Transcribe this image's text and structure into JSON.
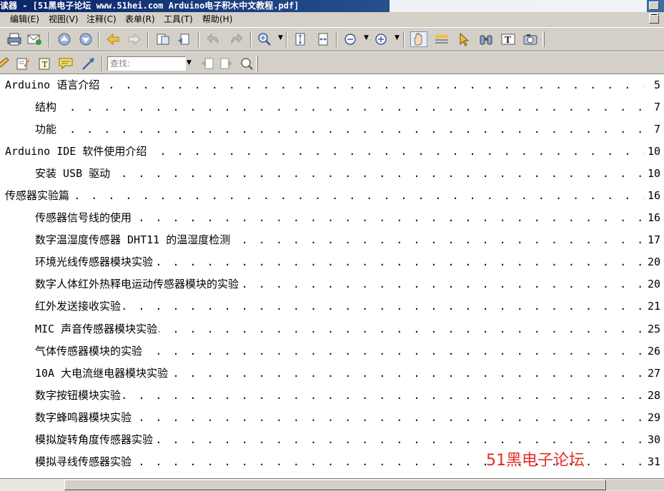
{
  "window": {
    "title": "读器 - [51黑电子论坛 www.51hei.com Arduino电子积木中文教程.pdf]"
  },
  "menu": [
    "编辑(E)",
    "视图(V)",
    "注释(C)",
    "表单(R)",
    "工具(T)",
    "帮助(H)"
  ],
  "toolbar2": {
    "find_placeholder": "查找:"
  },
  "toc": [
    {
      "title": "Arduino 语言介绍",
      "page": "5"
    },
    {
      "title": "结构",
      "page": "7"
    },
    {
      "title": "功能",
      "page": "7"
    },
    {
      "title": "Arduino IDE 软件使用介绍",
      "page": "10"
    },
    {
      "title": "安装 USB 驱动",
      "page": "10"
    },
    {
      "title": "传感器实验篇",
      "page": "16"
    },
    {
      "title": "传感器信号线的使用",
      "page": "16"
    },
    {
      "title": "数字温湿度传感器 DHT11 的温湿度检测",
      "page": "17"
    },
    {
      "title": "环境光线传感器模块实验",
      "page": "20"
    },
    {
      "title": "数字人体红外热释电运动传感器模块的实验",
      "page": "20"
    },
    {
      "title": "红外发送接收实验",
      "page": "21"
    },
    {
      "title": "MIC 声音传感器模块实验",
      "page": "25"
    },
    {
      "title": "气体传感器模块的实验",
      "page": "26"
    },
    {
      "title": "10A 大电流继电器模块实验",
      "page": "27"
    },
    {
      "title": "数字按钮模块实验",
      "page": "28"
    },
    {
      "title": "数字蜂鸣器模块实验",
      "page": "29"
    },
    {
      "title": "模拟旋转角度传感器实验",
      "page": "30"
    },
    {
      "title": "模拟寻线传感器实验",
      "page": "31"
    }
  ],
  "toc_leader": ". . . . . . . . . . . . . . . . . . . . . . . . . . . . . . . . . . . . . . . . . . . . . . . . . . . . . . . . . . . . . . . . . . . . . . . . . . . . . . . . . . . . . . .",
  "watermark": "51黑电子论坛",
  "icons": {
    "toolbar1": [
      "print-icon",
      "email-icon",
      "page-up-icon",
      "page-down-icon",
      "back-icon",
      "forward-icon",
      "copy-page-icon",
      "extract-page-icon",
      "undo-icon",
      "redo-icon",
      "zoom-in-icon",
      "fit-page-icon",
      "fit-width-icon",
      "zoom-out-icon",
      "zoom-plus-icon",
      "hand-tool-icon",
      "text-select-icon",
      "select-arrow-icon",
      "binoculars-icon",
      "text-tool-icon",
      "snapshot-icon"
    ],
    "toolbar2": [
      "pencil-icon",
      "note-icon",
      "text-box-icon",
      "comment-icon",
      "arrow-tool-icon",
      "find-previous-icon",
      "find-next-icon",
      "search-icon"
    ]
  },
  "colors": {
    "title_bar": "#0a246a",
    "chrome": "#d4d0c8",
    "watermark": "#e0302a"
  }
}
